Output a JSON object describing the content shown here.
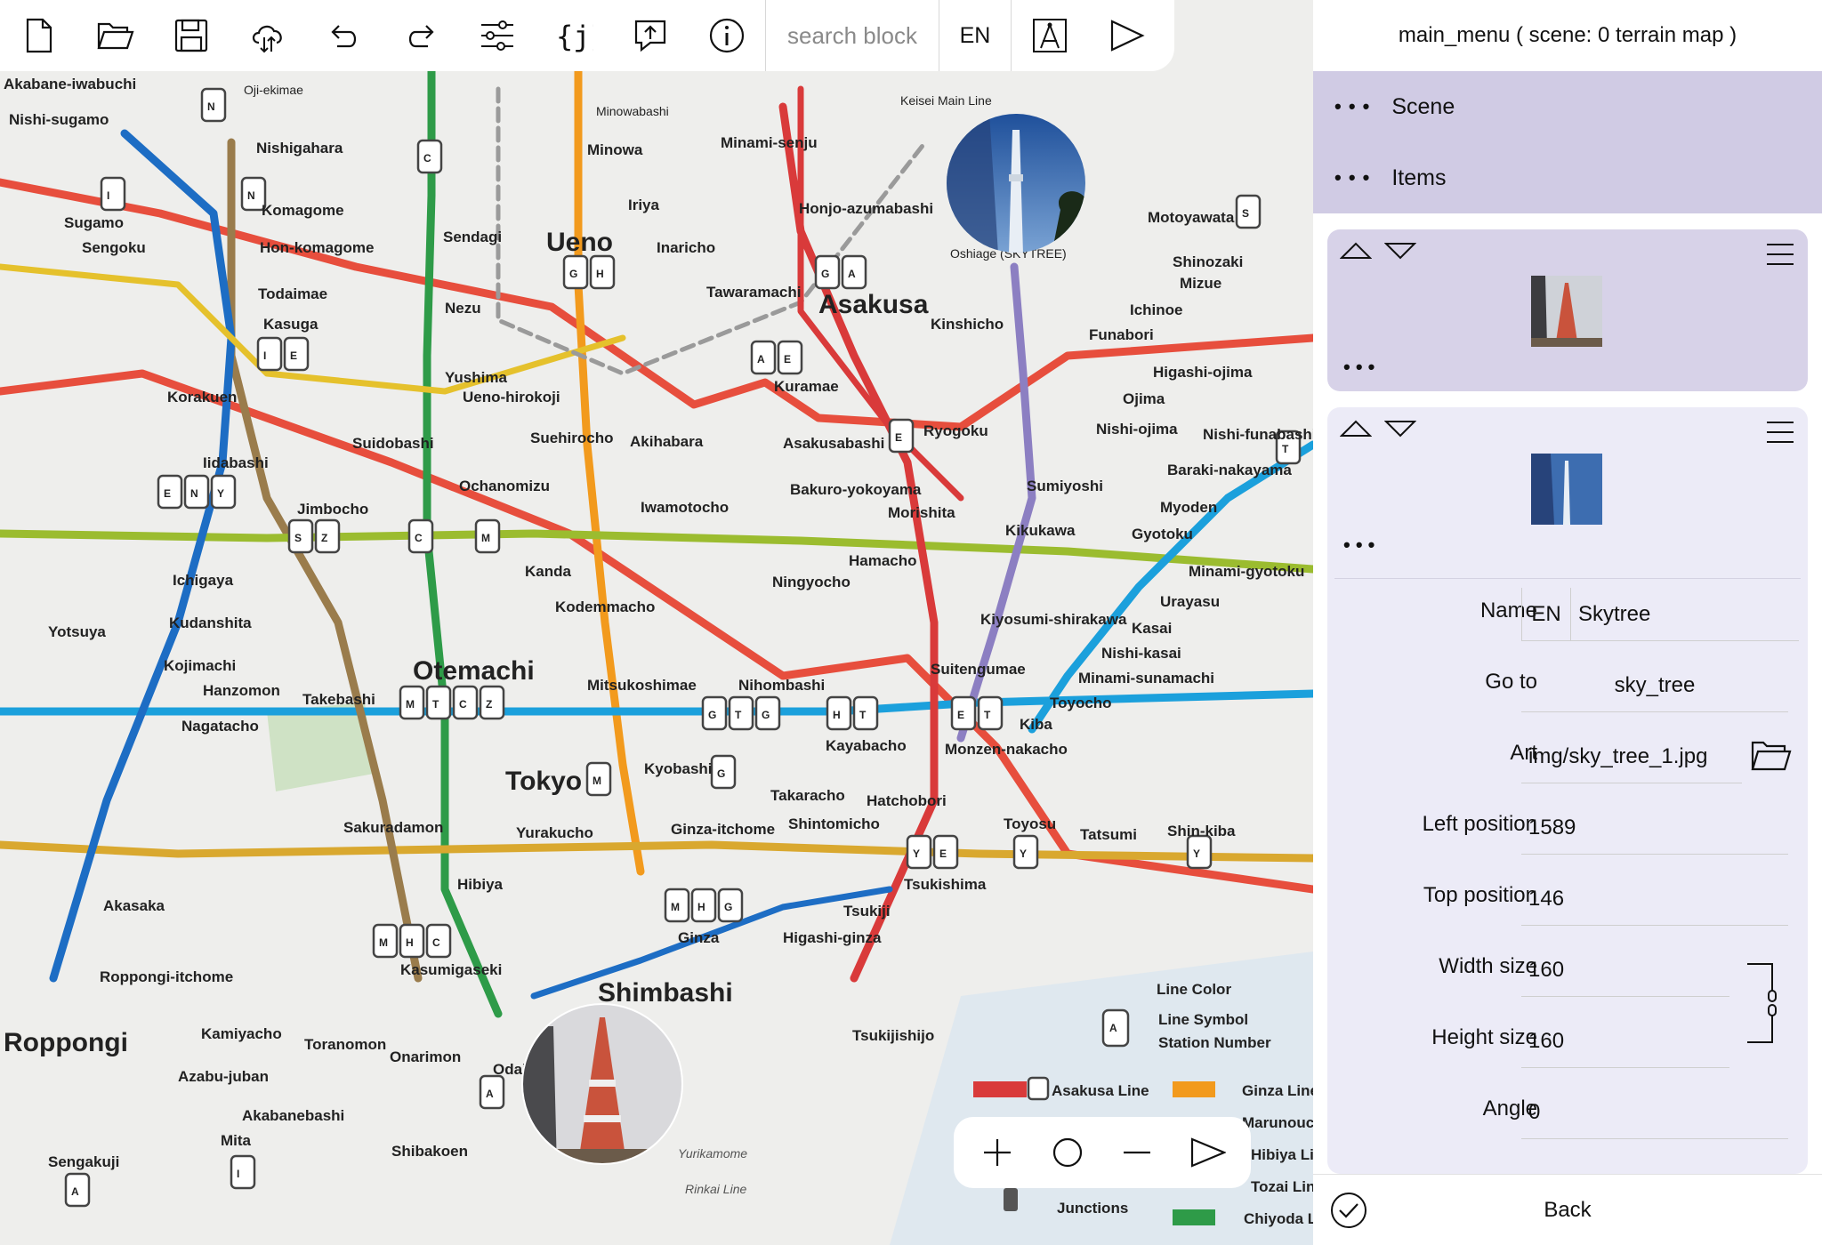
{
  "toolbar": {
    "icons": [
      "new-file-icon",
      "open-folder-icon",
      "save-icon",
      "cloud-sync-icon",
      "undo-icon",
      "redo-icon",
      "sliders-icon",
      "json-braces-icon",
      "share-icon",
      "info-icon"
    ],
    "search_placeholder": "search block",
    "language": "EN"
  },
  "map": {
    "stations": [
      {
        "name": "Akabane-iwabuchi"
      },
      {
        "name": "Oji-ekimae"
      },
      {
        "name": "Minowabashi"
      },
      {
        "name": "Keisei Main Line"
      },
      {
        "name": "Nishi-sugamo"
      },
      {
        "name": "Nishigahara"
      },
      {
        "name": "Minowa"
      },
      {
        "name": "Minami-senju"
      },
      {
        "name": "Ueno"
      },
      {
        "name": "Iriya"
      },
      {
        "name": "Inaricho"
      },
      {
        "name": "Tawaramachi"
      },
      {
        "name": "Asakusa"
      },
      {
        "name": "Komagome"
      },
      {
        "name": "Sugamo"
      },
      {
        "name": "Sengoku"
      },
      {
        "name": "Hon-komagome"
      },
      {
        "name": "Sendagi"
      },
      {
        "name": "Todaimae"
      },
      {
        "name": "Nezu"
      },
      {
        "name": "Kasuga"
      },
      {
        "name": "Korakuen"
      },
      {
        "name": "Yushima"
      },
      {
        "name": "Ueno-hirokoji"
      },
      {
        "name": "Kuramae"
      },
      {
        "name": "Kinshicho"
      },
      {
        "name": "Ryogoku"
      },
      {
        "name": "Suidobashi"
      },
      {
        "name": "Iidabashi"
      },
      {
        "name": "Ochanomizu"
      },
      {
        "name": "Suehirocho"
      },
      {
        "name": "Akihabara"
      },
      {
        "name": "Asakusabashi"
      },
      {
        "name": "Morishita"
      },
      {
        "name": "Kikukawa"
      },
      {
        "name": "Sumiyoshi"
      },
      {
        "name": "Jimbocho"
      },
      {
        "name": "Iwamotocho"
      },
      {
        "name": "Bakuro-yokoyama"
      },
      {
        "name": "Hamacho"
      },
      {
        "name": "Ningyocho"
      },
      {
        "name": "Ichigaya"
      },
      {
        "name": "Kanda"
      },
      {
        "name": "Kodemmacho"
      },
      {
        "name": "Otemachi"
      },
      {
        "name": "Mitsukoshimae"
      },
      {
        "name": "Nihombashi"
      },
      {
        "name": "Kudanshita"
      },
      {
        "name": "Yotsuya"
      },
      {
        "name": "Kojimachi"
      },
      {
        "name": "Hanzomon"
      },
      {
        "name": "Takebashi"
      },
      {
        "name": "Kayabacho"
      },
      {
        "name": "Suitengumae"
      },
      {
        "name": "Monzen-nakacho"
      },
      {
        "name": "Kiba"
      },
      {
        "name": "Toyocho"
      },
      {
        "name": "Tokyo"
      },
      {
        "name": "Kyobashi"
      },
      {
        "name": "Takaracho"
      },
      {
        "name": "Hatchobori"
      },
      {
        "name": "Nagatacho"
      },
      {
        "name": "Sakuradamon"
      },
      {
        "name": "Yurakucho"
      },
      {
        "name": "Ginza-itchome"
      },
      {
        "name": "Shintomicho"
      },
      {
        "name": "Tsukishima"
      },
      {
        "name": "Toyosu"
      },
      {
        "name": "Tatsumi"
      },
      {
        "name": "Shin-kiba"
      },
      {
        "name": "Hibiya"
      },
      {
        "name": "Ginza"
      },
      {
        "name": "Higashi-ginza"
      },
      {
        "name": "Tsukiji"
      },
      {
        "name": "Kasumigaseki"
      },
      {
        "name": "Akasaka"
      },
      {
        "name": "Roppongi-itchome"
      },
      {
        "name": "Kamiyacho"
      },
      {
        "name": "Toranomon"
      },
      {
        "name": "Onarimon"
      },
      {
        "name": "Shimbashi"
      },
      {
        "name": "Tsukijishijo"
      },
      {
        "name": "Azabu-juban"
      },
      {
        "name": "Akabanebashi"
      },
      {
        "name": "Shibakoen"
      },
      {
        "name": "Mita"
      },
      {
        "name": "Sengakuji"
      },
      {
        "name": "Roppongi"
      },
      {
        "name": "Odaiba"
      },
      {
        "name": "Yurikamome"
      },
      {
        "name": "Rinkai Line"
      },
      {
        "name": "Motoyawata"
      },
      {
        "name": "Shinozaki"
      },
      {
        "name": "Mizue"
      },
      {
        "name": "Ichinoe"
      },
      {
        "name": "Funabori"
      },
      {
        "name": "Higashi-ojima"
      },
      {
        "name": "Ojima"
      },
      {
        "name": "Nishi-ojima"
      },
      {
        "name": "Nishi-funabashi"
      },
      {
        "name": "Baraki-nakayama"
      },
      {
        "name": "Myoden"
      },
      {
        "name": "Gyotoku"
      },
      {
        "name": "Minami-gyotoku"
      },
      {
        "name": "Urayasu"
      },
      {
        "name": "Kasai"
      },
      {
        "name": "Nishi-kasai"
      },
      {
        "name": "Minami-sunamachi"
      },
      {
        "name": "Kiyosumi-shirakawa"
      },
      {
        "name": "Oshiage (SKYTREE)"
      },
      {
        "name": "Honjo-azumabashi"
      }
    ],
    "legend": {
      "line_color": "Line Color",
      "line_symbol": "Line Symbol",
      "station_number": "Station Number",
      "junctions": "Junctions"
    },
    "legend_lines": [
      "Asakusa Line",
      "Ginza Line",
      "Marunouchi",
      "Hibiya Line",
      "Tozai Line",
      "Chiyoda Line"
    ]
  },
  "zoom": {
    "icons": [
      "zoom-in-icon",
      "reset-zoom-icon",
      "zoom-out-icon",
      "play-icon"
    ]
  },
  "panel": {
    "title": "main_menu ( scene: 0 terrain map )",
    "sections": [
      {
        "label": "Scene"
      },
      {
        "label": "Items"
      }
    ],
    "form": {
      "name_label": "Name",
      "name_lang": "EN",
      "name_value": "Skytree",
      "goto_label": "Go to",
      "goto_value": "sky_tree",
      "art_label": "Art",
      "art_value": "img/sky_tree_1.jpg",
      "left_label": "Left position",
      "left_value": "1589",
      "top_label": "Top position",
      "top_value": "146",
      "width_label": "Width size",
      "width_value": "160",
      "height_label": "Height size",
      "height_value": "160",
      "angle_label": "Angle",
      "angle_value": "0"
    },
    "back_label": "Back"
  },
  "colors": {
    "accent": "#d0cbe4",
    "card_selected": "#d7d2e8",
    "card_normal": "#ecebf7"
  }
}
